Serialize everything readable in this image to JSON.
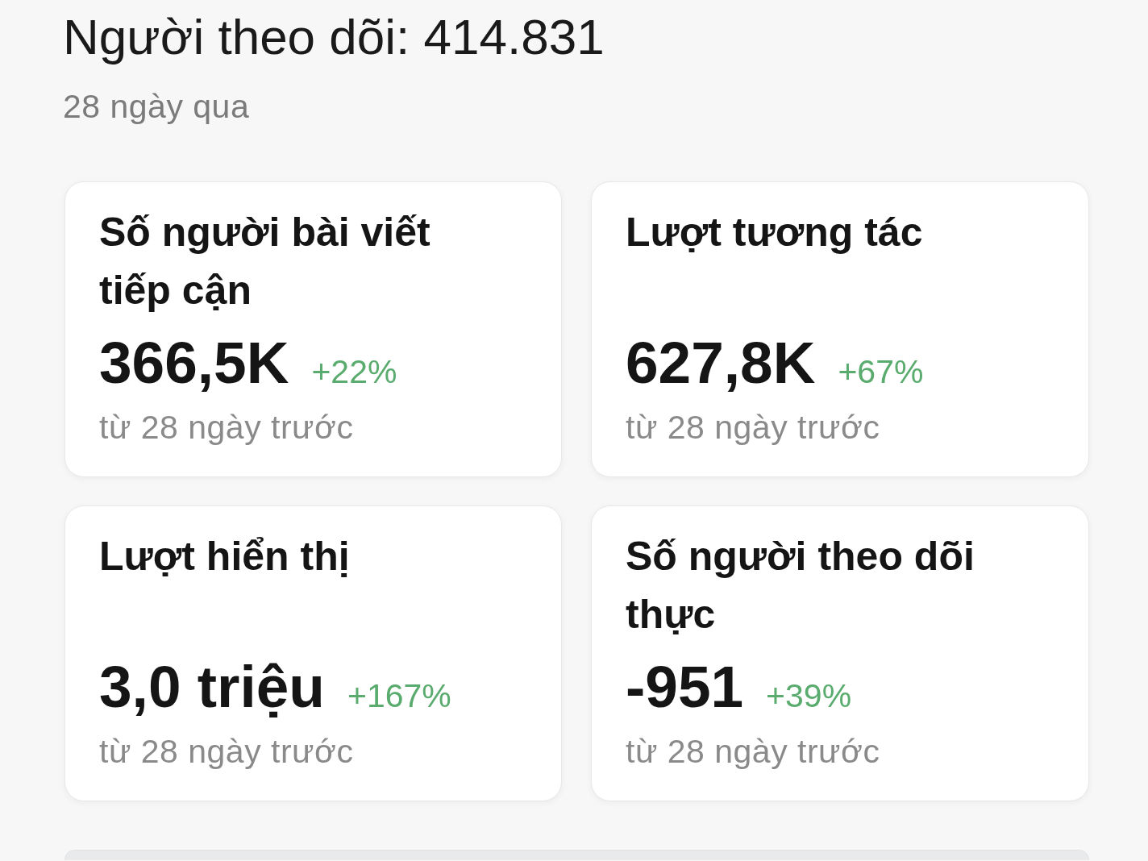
{
  "header": {
    "followers": "Người theo dõi: 414.831",
    "period": "28 ngày qua"
  },
  "metrics": [
    {
      "title": "Số người bài viết tiếp cận",
      "value": "366,5K",
      "change": "+22%",
      "comparison": "từ 28 ngày trước"
    },
    {
      "title": "Lượt tương tác",
      "value": "627,8K",
      "change": "+67%",
      "comparison": "từ 28 ngày trước"
    },
    {
      "title": "Lượt hiển thị",
      "value": "3,0 triệu",
      "change": "+167%",
      "comparison": "từ 28 ngày trước"
    },
    {
      "title": "Số người theo dõi thực",
      "value": "-951",
      "change": "+39%",
      "comparison": "từ 28 ngày trước"
    }
  ]
}
